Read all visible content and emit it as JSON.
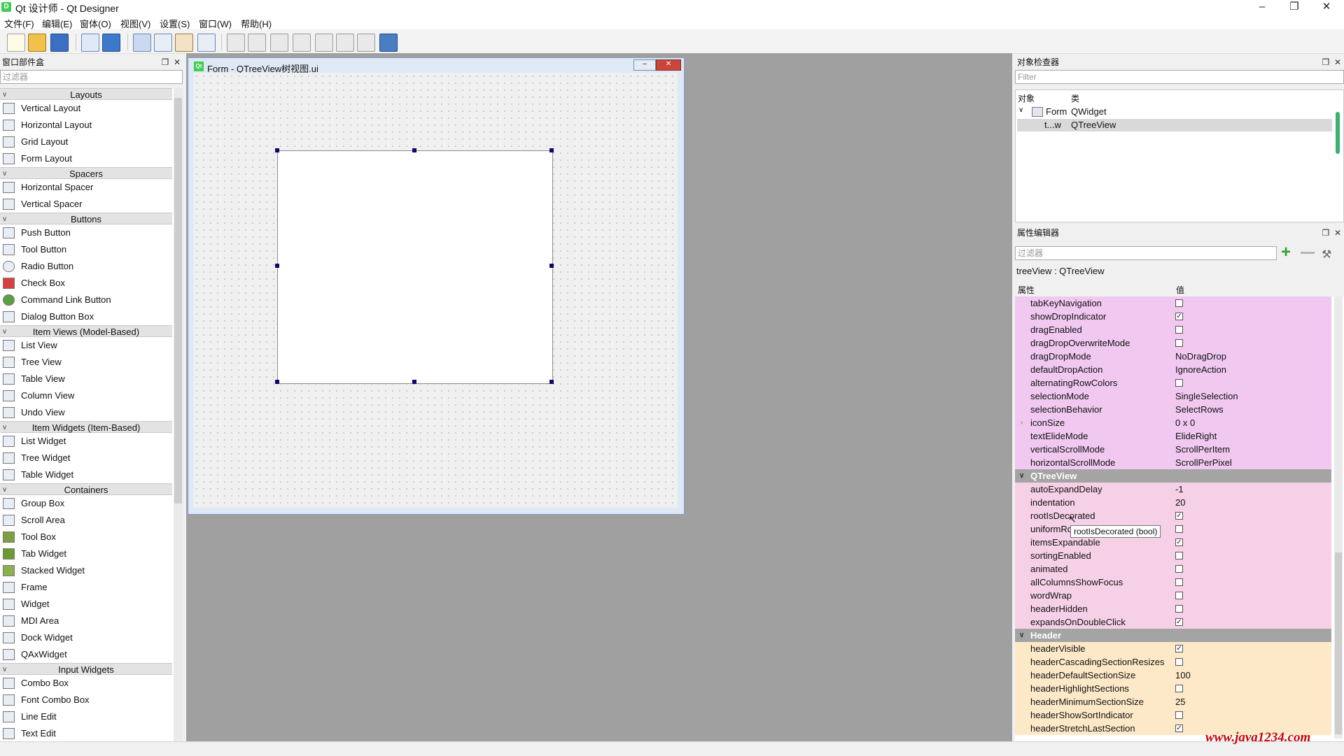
{
  "window": {
    "title": "Qt 设计师 - Qt Designer",
    "app_icon_letter": "D"
  },
  "menu": [
    "文件(F)",
    "编辑(E)",
    "窗体(O)",
    "视图(V)",
    "设置(S)",
    "窗口(W)",
    "帮助(H)"
  ],
  "widget_box": {
    "title": "窗口部件盒",
    "filter_placeholder": "过滤器",
    "categories": {
      "layouts": "Layouts",
      "spacers": "Spacers",
      "buttons": "Buttons",
      "item_views": "Item Views (Model-Based)",
      "item_widgets": "Item Widgets (Item-Based)",
      "containers": "Containers",
      "input_widgets": "Input Widgets"
    },
    "items": {
      "vertical_layout": "Vertical Layout",
      "horizontal_layout": "Horizontal Layout",
      "grid_layout": "Grid Layout",
      "form_layout": "Form Layout",
      "horizontal_spacer": "Horizontal Spacer",
      "vertical_spacer": "Vertical Spacer",
      "push_button": "Push Button",
      "tool_button": "Tool Button",
      "radio_button": "Radio Button",
      "check_box": "Check Box",
      "command_link_button": "Command Link Button",
      "dialog_button_box": "Dialog Button Box",
      "list_view": "List View",
      "tree_view": "Tree View",
      "table_view": "Table View",
      "column_view": "Column View",
      "undo_view": "Undo View",
      "list_widget": "List Widget",
      "tree_widget": "Tree Widget",
      "table_widget": "Table Widget",
      "group_box": "Group Box",
      "scroll_area": "Scroll Area",
      "tool_box": "Tool Box",
      "tab_widget": "Tab Widget",
      "stacked_widget": "Stacked Widget",
      "frame": "Frame",
      "widget": "Widget",
      "mdi_area": "MDI Area",
      "dock_widget": "Dock Widget",
      "qax_widget": "QAxWidget",
      "combo_box": "Combo Box",
      "font_combo_box": "Font Combo Box",
      "line_edit": "Line Edit",
      "text_edit": "Text Edit"
    }
  },
  "form": {
    "title": "Form - QTreeView树视图.ui",
    "icon": "Qt"
  },
  "object_inspector": {
    "title": "对象检查器",
    "filter_placeholder": "Filter",
    "col_object": "对象",
    "col_class": "类",
    "rows": [
      {
        "object": "Form",
        "class": "QWidget"
      },
      {
        "object": "t...w",
        "class": "QTreeView"
      }
    ]
  },
  "property_editor": {
    "title": "属性编辑器",
    "filter_placeholder": "过滤器",
    "object_label": "treeView : QTreeView",
    "col_property": "属性",
    "col_value": "值",
    "props": {
      "tabKeyNavigation": "tabKeyNavigation",
      "showDropIndicator": "showDropIndicator",
      "dragEnabled": "dragEnabled",
      "dragDropOverwriteMode": "dragDropOverwriteMode",
      "dragDropMode": "dragDropMode",
      "dragDropMode_val": "NoDragDrop",
      "defaultDropAction": "defaultDropAction",
      "defaultDropAction_val": "IgnoreAction",
      "alternatingRowColors": "alternatingRowColors",
      "selectionMode": "selectionMode",
      "selectionMode_val": "SingleSelection",
      "selectionBehavior": "selectionBehavior",
      "selectionBehavior_val": "SelectRows",
      "iconSize": "iconSize",
      "iconSize_val": "0 x 0",
      "textElideMode": "textElideMode",
      "textElideMode_val": "ElideRight",
      "verticalScrollMode": "verticalScrollMode",
      "verticalScrollMode_val": "ScrollPerItem",
      "horizontalScrollMode": "horizontalScrollMode",
      "horizontalScrollMode_val": "ScrollPerPixel",
      "grp_qtreeview": "QTreeView",
      "autoExpandDelay": "autoExpandDelay",
      "autoExpandDelay_val": "-1",
      "indentation": "indentation",
      "indentation_val": "20",
      "rootIsDecorated": "rootIsDecorated",
      "uniformRowHeights_trunc": "uniformRo",
      "itemsExpandable": "itemsExpandable",
      "sortingEnabled": "sortingEnabled",
      "animated": "animated",
      "allColumnsShowFocus": "allColumnsShowFocus",
      "wordWrap": "wordWrap",
      "headerHidden": "headerHidden",
      "expandsOnDoubleClick": "expandsOnDoubleClick",
      "grp_header": "Header",
      "headerVisible": "headerVisible",
      "headerCascadingSectionResizes": "headerCascadingSectionResizes",
      "headerDefaultSectionSize": "headerDefaultSectionSize",
      "headerDefaultSectionSize_val": "100",
      "headerHighlightSections": "headerHighlightSections",
      "headerMinimumSectionSize": "headerMinimumSectionSize",
      "headerMinimumSectionSize_val": "25",
      "headerShowSortIndicator": "headerShowSortIndicator",
      "headerStretchLastSection": "headerStretchLastSection"
    },
    "tooltip": "rootIsDecorated (bool)"
  },
  "watermark": "www.java1234.com",
  "colors": {
    "qabstractitemview_row": "#f0c8f0",
    "qtreeview_row": "#f5d0e6",
    "header_row": "#fde9c8",
    "group_row": "#a4a4a4"
  }
}
